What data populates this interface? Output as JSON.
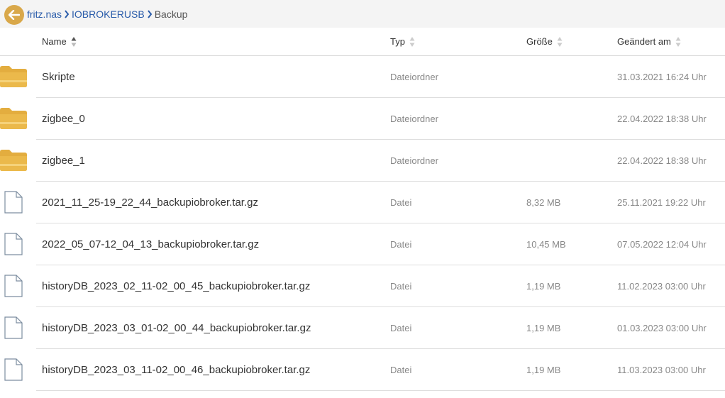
{
  "breadcrumb": {
    "items": [
      {
        "label": "fritz.nas"
      },
      {
        "label": "IOBROKERUSB"
      },
      {
        "label": "Backup"
      }
    ]
  },
  "columns": {
    "name": "Name",
    "type": "Typ",
    "size": "Größe",
    "modified": "Geändert am"
  },
  "rows": [
    {
      "name": "Skripte",
      "type": "Dateiordner",
      "size": "",
      "modified": "31.03.2021 16:24 Uhr",
      "icon": "folder-icon"
    },
    {
      "name": "zigbee_0",
      "type": "Dateiordner",
      "size": "",
      "modified": "22.04.2022 18:38 Uhr",
      "icon": "folder-icon"
    },
    {
      "name": "zigbee_1",
      "type": "Dateiordner",
      "size": "",
      "modified": "22.04.2022 18:38 Uhr",
      "icon": "folder-icon"
    },
    {
      "name": "2021_11_25-19_22_44_backupiobroker.tar.gz",
      "type": "Datei",
      "size": "8,32 MB",
      "modified": "25.11.2021 19:22 Uhr",
      "icon": "file-icon"
    },
    {
      "name": "2022_05_07-12_04_13_backupiobroker.tar.gz",
      "type": "Datei",
      "size": "10,45 MB",
      "modified": "07.05.2022 12:04 Uhr",
      "icon": "file-icon"
    },
    {
      "name": "historyDB_2023_02_11-02_00_45_backupiobroker.tar.gz",
      "type": "Datei",
      "size": "1,19 MB",
      "modified": "11.02.2023 03:00 Uhr",
      "icon": "file-icon"
    },
    {
      "name": "historyDB_2023_03_01-02_00_44_backupiobroker.tar.gz",
      "type": "Datei",
      "size": "1,19 MB",
      "modified": "01.03.2023 03:00 Uhr",
      "icon": "file-icon"
    },
    {
      "name": "historyDB_2023_03_11-02_00_46_backupiobroker.tar.gz",
      "type": "Datei",
      "size": "1,19 MB",
      "modified": "11.03.2023 03:00 Uhr",
      "icon": "file-icon"
    }
  ],
  "colors": {
    "accent": "#d9a84a",
    "link": "#2a5caa",
    "folder": "#e3ad3f"
  }
}
